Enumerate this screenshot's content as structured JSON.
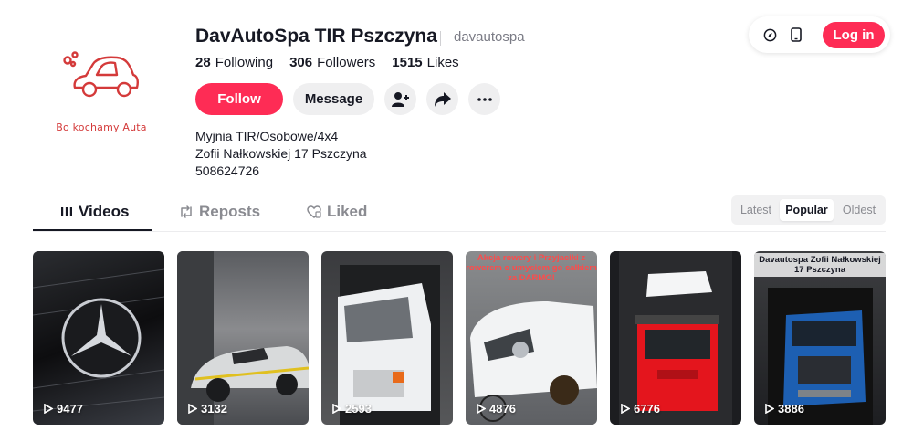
{
  "profile": {
    "name": "DavAutoSpa TIR Pszczyna",
    "handle": "davautospa",
    "avatar_text": "Bo kochamy Auta",
    "stats": [
      {
        "value": "28",
        "label": "Following"
      },
      {
        "value": "306",
        "label": "Followers"
      },
      {
        "value": "1515",
        "label": "Likes"
      }
    ],
    "follow_label": "Follow",
    "message_label": "Message",
    "bio": [
      "Myjnia TIR/Osobowe/4x4",
      "Zofii Nałkowskiej 17 Pszczyna",
      "508624726"
    ]
  },
  "header": {
    "login_label": "Log in"
  },
  "tabs": [
    {
      "label": "Videos",
      "icon": "grid-icon"
    },
    {
      "label": "Reposts",
      "icon": "repost-icon"
    },
    {
      "label": "Liked",
      "icon": "liked-heart-icon"
    }
  ],
  "sort_options": [
    "Latest",
    "Popular",
    "Oldest"
  ],
  "sort_selected": "Popular",
  "videos": [
    {
      "views": "9477",
      "overlay": ""
    },
    {
      "views": "3132",
      "overlay": ""
    },
    {
      "views": "2593",
      "overlay": ""
    },
    {
      "views": "4876",
      "overlay": "Akcja rowery i Przyjaciki z rowerem o umyciem go całkiem za DARMO!"
    },
    {
      "views": "6776",
      "overlay": ""
    },
    {
      "views": "3886",
      "overlay": "Davautospa Zofii Nałkowskiej 17 Pszczyna"
    }
  ],
  "colors": {
    "brand": "#fe2c55",
    "text": "#161823",
    "muted": "#8a8b91"
  }
}
